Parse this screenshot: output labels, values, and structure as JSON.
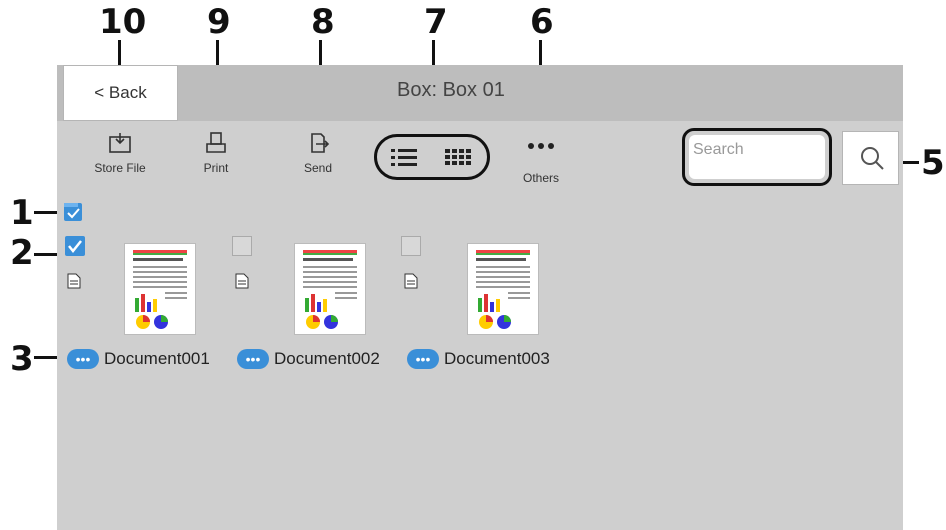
{
  "callouts": [
    "1",
    "2",
    "3",
    "5",
    "6",
    "7",
    "8",
    "9",
    "10"
  ],
  "titlebar": {
    "back_label": "< Back",
    "title": "Box: Box 01"
  },
  "toolbar": {
    "store_file": "Store File",
    "print": "Print",
    "send": "Send",
    "others": "Others"
  },
  "search": {
    "placeholder": "Search"
  },
  "documents": [
    {
      "name": "Document001",
      "checked": true
    },
    {
      "name": "Document002",
      "checked": false
    },
    {
      "name": "Document003",
      "checked": false
    }
  ],
  "colors": {
    "accent": "#3a8fd8",
    "screen_bg": "#cfcfcf",
    "titlebar_bg": "#bdbdbd"
  },
  "icons": [
    "store-file-icon",
    "print-icon",
    "send-icon",
    "list-view-icon",
    "grid-view-icon",
    "more-icon",
    "search-icon",
    "document-icon",
    "doc-menu-icon"
  ]
}
